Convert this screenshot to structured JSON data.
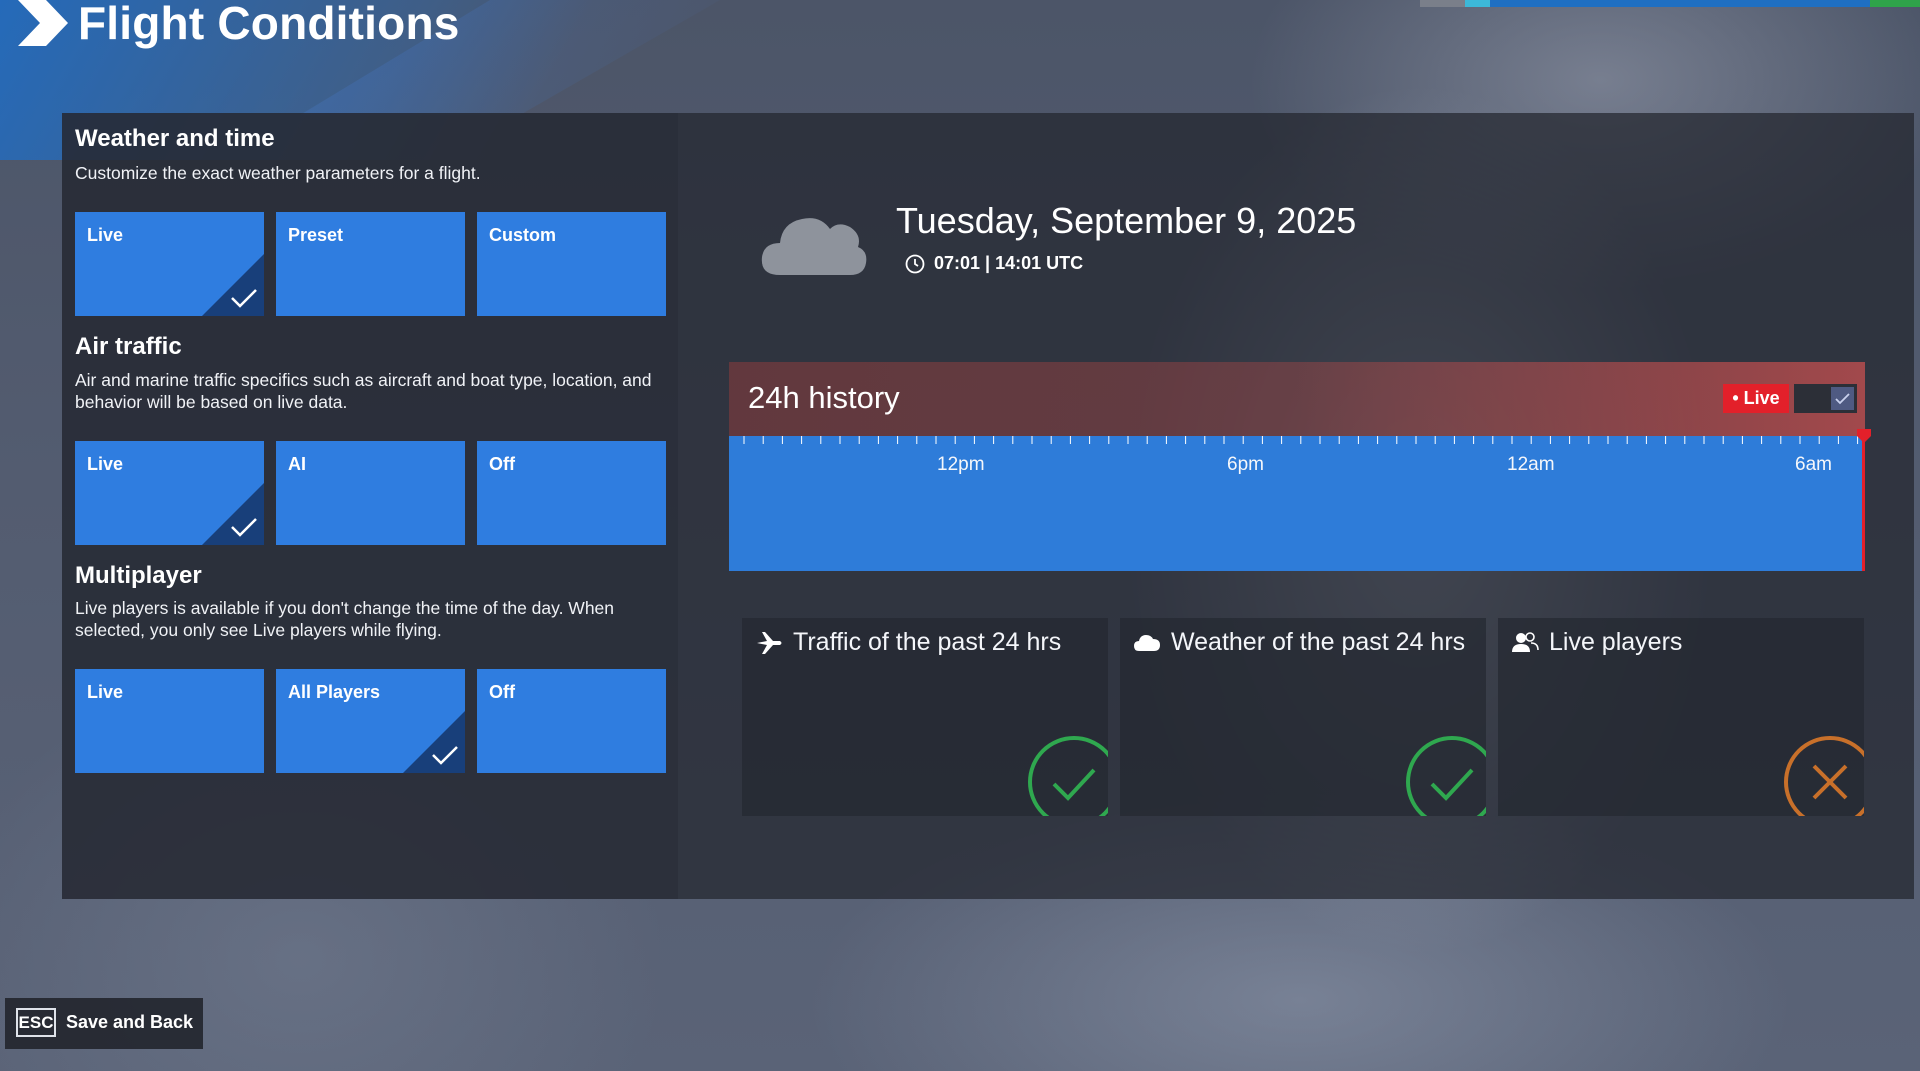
{
  "page": {
    "title": "Flight Conditions"
  },
  "weather_time": {
    "title": "Weather and time",
    "description": "Customize the exact weather parameters for a flight.",
    "options": [
      {
        "label": "Live",
        "selected": true
      },
      {
        "label": "Preset",
        "selected": false
      },
      {
        "label": "Custom",
        "selected": false
      }
    ]
  },
  "air_traffic": {
    "title": "Air traffic",
    "description": "Air and marine traffic specifics such as aircraft and boat type, location, and behavior will be based on live data.",
    "options": [
      {
        "label": "Live",
        "selected": true
      },
      {
        "label": "AI",
        "selected": false
      },
      {
        "label": "Off",
        "selected": false
      }
    ]
  },
  "multiplayer": {
    "title": "Multiplayer",
    "description": "Live players is available if you don't change the time of the day. When selected, you only see Live players while flying.",
    "options": [
      {
        "label": "Live",
        "selected": false
      },
      {
        "label": "All Players",
        "selected": true
      },
      {
        "label": "Off",
        "selected": false
      }
    ]
  },
  "conditions": {
    "date": "Tuesday, September 9, 2025",
    "time": "07:01 | 14:01 UTC",
    "weather_icon": "cloud-icon"
  },
  "history": {
    "title": "24h history",
    "live_badge": "• Live",
    "live_toggle_checked": true,
    "tick_labels": [
      "12pm",
      "6pm",
      "12am",
      "6am"
    ]
  },
  "cards": [
    {
      "label": "Traffic of the past 24 hrs",
      "icon": "airplane-icon",
      "status": "ok"
    },
    {
      "label": "Weather of the past 24 hrs",
      "icon": "cloud-icon",
      "status": "ok"
    },
    {
      "label": "Live players",
      "icon": "players-icon",
      "status": "unavailable"
    }
  ],
  "footer": {
    "key": "ESC",
    "label": "Save and Back"
  },
  "colors": {
    "accent_blue": "#2f7de0",
    "live_red": "#e3202a",
    "status_ok": "#2fa84f",
    "status_off": "#c8702a"
  }
}
